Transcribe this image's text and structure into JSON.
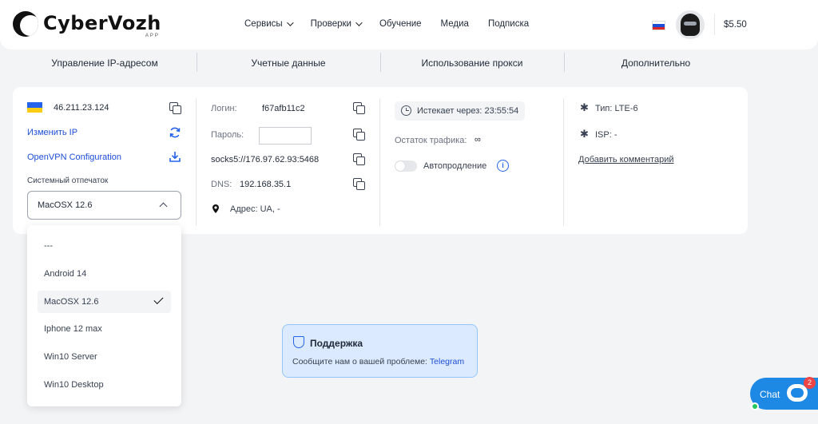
{
  "header": {
    "logo_text": "CyberVozh",
    "logo_sub": "APP",
    "nav": [
      {
        "label": "Сервисы",
        "dropdown": true
      },
      {
        "label": "Проверки",
        "dropdown": true
      },
      {
        "label": "Обучение",
        "dropdown": false
      },
      {
        "label": "Медиа",
        "dropdown": false
      },
      {
        "label": "Подписка",
        "dropdown": false
      }
    ],
    "balance": "$5.50"
  },
  "tabs": [
    "Управление IP-адресом",
    "Учетные данные",
    "Использование прокси",
    "Дополнительно"
  ],
  "ip_panel": {
    "ip": "46.211.23.124",
    "change_ip": "Изменить IP",
    "openvpn": "OpenVPN Configuration",
    "fingerprint_label": "Системный отпечаток",
    "fingerprint_value": "MacOSX 12.6"
  },
  "credentials": {
    "login_label": "Логин:",
    "login_value": "f67afb11c2",
    "password_label": "Пароль:",
    "proxy_string": "socks5://176.97.62.93:5468",
    "dns_label": "DNS:",
    "dns_value": "192.168.35.1",
    "address": "Адрес: UA, -"
  },
  "usage": {
    "expires": "Истекает через: 23:55:54",
    "traffic_label": "Остаток трафика:",
    "traffic_value": "∞",
    "autorenew": "Автопродление"
  },
  "extra": {
    "type": "Тип: LTE-6",
    "isp": "ISP: -",
    "add_comment": "Добавить комментарий"
  },
  "fingerprint_options": [
    {
      "label": "---",
      "selected": false
    },
    {
      "label": "Android 14",
      "selected": false
    },
    {
      "label": "MacOSX 12.6",
      "selected": true
    },
    {
      "label": "Iphone 12 max",
      "selected": false
    },
    {
      "label": "Win10 Server",
      "selected": false
    },
    {
      "label": "Win10 Desktop",
      "selected": false
    }
  ],
  "support": {
    "title": "Поддержка",
    "desc": "Сообщите нам о вашей проблеме:",
    "link": "Telegram"
  },
  "chat": {
    "label": "Chat",
    "badge": "2"
  },
  "colors": {
    "accent": "#1d4ed8",
    "chat": "#1e88e5",
    "support_bg": "#dbeafe",
    "badge": "#ef4444"
  }
}
